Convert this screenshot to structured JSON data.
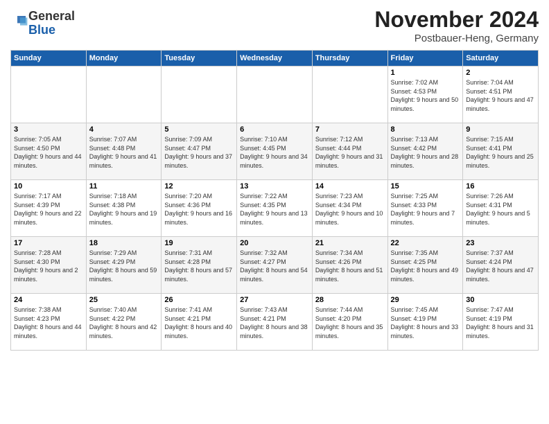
{
  "logo": {
    "general": "General",
    "blue": "Blue"
  },
  "header": {
    "month": "November 2024",
    "location": "Postbauer-Heng, Germany"
  },
  "weekdays": [
    "Sunday",
    "Monday",
    "Tuesday",
    "Wednesday",
    "Thursday",
    "Friday",
    "Saturday"
  ],
  "weeks": [
    [
      {
        "day": "",
        "info": ""
      },
      {
        "day": "",
        "info": ""
      },
      {
        "day": "",
        "info": ""
      },
      {
        "day": "",
        "info": ""
      },
      {
        "day": "",
        "info": ""
      },
      {
        "day": "1",
        "info": "Sunrise: 7:02 AM\nSunset: 4:53 PM\nDaylight: 9 hours and 50 minutes."
      },
      {
        "day": "2",
        "info": "Sunrise: 7:04 AM\nSunset: 4:51 PM\nDaylight: 9 hours and 47 minutes."
      }
    ],
    [
      {
        "day": "3",
        "info": "Sunrise: 7:05 AM\nSunset: 4:50 PM\nDaylight: 9 hours and 44 minutes."
      },
      {
        "day": "4",
        "info": "Sunrise: 7:07 AM\nSunset: 4:48 PM\nDaylight: 9 hours and 41 minutes."
      },
      {
        "day": "5",
        "info": "Sunrise: 7:09 AM\nSunset: 4:47 PM\nDaylight: 9 hours and 37 minutes."
      },
      {
        "day": "6",
        "info": "Sunrise: 7:10 AM\nSunset: 4:45 PM\nDaylight: 9 hours and 34 minutes."
      },
      {
        "day": "7",
        "info": "Sunrise: 7:12 AM\nSunset: 4:44 PM\nDaylight: 9 hours and 31 minutes."
      },
      {
        "day": "8",
        "info": "Sunrise: 7:13 AM\nSunset: 4:42 PM\nDaylight: 9 hours and 28 minutes."
      },
      {
        "day": "9",
        "info": "Sunrise: 7:15 AM\nSunset: 4:41 PM\nDaylight: 9 hours and 25 minutes."
      }
    ],
    [
      {
        "day": "10",
        "info": "Sunrise: 7:17 AM\nSunset: 4:39 PM\nDaylight: 9 hours and 22 minutes."
      },
      {
        "day": "11",
        "info": "Sunrise: 7:18 AM\nSunset: 4:38 PM\nDaylight: 9 hours and 19 minutes."
      },
      {
        "day": "12",
        "info": "Sunrise: 7:20 AM\nSunset: 4:36 PM\nDaylight: 9 hours and 16 minutes."
      },
      {
        "day": "13",
        "info": "Sunrise: 7:22 AM\nSunset: 4:35 PM\nDaylight: 9 hours and 13 minutes."
      },
      {
        "day": "14",
        "info": "Sunrise: 7:23 AM\nSunset: 4:34 PM\nDaylight: 9 hours and 10 minutes."
      },
      {
        "day": "15",
        "info": "Sunrise: 7:25 AM\nSunset: 4:33 PM\nDaylight: 9 hours and 7 minutes."
      },
      {
        "day": "16",
        "info": "Sunrise: 7:26 AM\nSunset: 4:31 PM\nDaylight: 9 hours and 5 minutes."
      }
    ],
    [
      {
        "day": "17",
        "info": "Sunrise: 7:28 AM\nSunset: 4:30 PM\nDaylight: 9 hours and 2 minutes."
      },
      {
        "day": "18",
        "info": "Sunrise: 7:29 AM\nSunset: 4:29 PM\nDaylight: 8 hours and 59 minutes."
      },
      {
        "day": "19",
        "info": "Sunrise: 7:31 AM\nSunset: 4:28 PM\nDaylight: 8 hours and 57 minutes."
      },
      {
        "day": "20",
        "info": "Sunrise: 7:32 AM\nSunset: 4:27 PM\nDaylight: 8 hours and 54 minutes."
      },
      {
        "day": "21",
        "info": "Sunrise: 7:34 AM\nSunset: 4:26 PM\nDaylight: 8 hours and 51 minutes."
      },
      {
        "day": "22",
        "info": "Sunrise: 7:35 AM\nSunset: 4:25 PM\nDaylight: 8 hours and 49 minutes."
      },
      {
        "day": "23",
        "info": "Sunrise: 7:37 AM\nSunset: 4:24 PM\nDaylight: 8 hours and 47 minutes."
      }
    ],
    [
      {
        "day": "24",
        "info": "Sunrise: 7:38 AM\nSunset: 4:23 PM\nDaylight: 8 hours and 44 minutes."
      },
      {
        "day": "25",
        "info": "Sunrise: 7:40 AM\nSunset: 4:22 PM\nDaylight: 8 hours and 42 minutes."
      },
      {
        "day": "26",
        "info": "Sunrise: 7:41 AM\nSunset: 4:21 PM\nDaylight: 8 hours and 40 minutes."
      },
      {
        "day": "27",
        "info": "Sunrise: 7:43 AM\nSunset: 4:21 PM\nDaylight: 8 hours and 38 minutes."
      },
      {
        "day": "28",
        "info": "Sunrise: 7:44 AM\nSunset: 4:20 PM\nDaylight: 8 hours and 35 minutes."
      },
      {
        "day": "29",
        "info": "Sunrise: 7:45 AM\nSunset: 4:19 PM\nDaylight: 8 hours and 33 minutes."
      },
      {
        "day": "30",
        "info": "Sunrise: 7:47 AM\nSunset: 4:19 PM\nDaylight: 8 hours and 31 minutes."
      }
    ]
  ]
}
